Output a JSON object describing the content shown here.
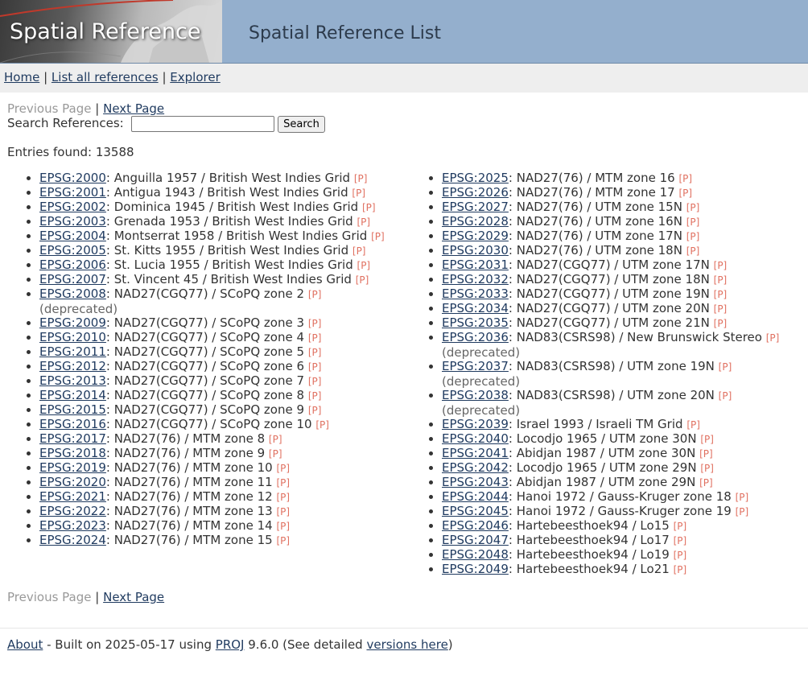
{
  "header": {
    "logo_text": "Spatial Reference",
    "title": "Spatial Reference List"
  },
  "nav": {
    "home": "Home",
    "list_all": "List all references",
    "explorer": "Explorer",
    "separator": "|"
  },
  "pager": {
    "previous": "Previous Page",
    "next": "Next Page",
    "separator": "|"
  },
  "search": {
    "label": "Search References:",
    "value": "",
    "button": "Search"
  },
  "entries_text": "Entries found: 13588",
  "p_tag": "[P]",
  "deprecated_text": "(deprecated)",
  "left_column": [
    {
      "code": "EPSG:2000",
      "name": ": Anguilla 1957 / British West Indies Grid",
      "deprecated": false
    },
    {
      "code": "EPSG:2001",
      "name": ": Antigua 1943 / British West Indies Grid",
      "deprecated": false
    },
    {
      "code": "EPSG:2002",
      "name": ": Dominica 1945 / British West Indies Grid",
      "deprecated": false
    },
    {
      "code": "EPSG:2003",
      "name": ": Grenada 1953 / British West Indies Grid",
      "deprecated": false
    },
    {
      "code": "EPSG:2004",
      "name": ": Montserrat 1958 / British West Indies Grid",
      "deprecated": false
    },
    {
      "code": "EPSG:2005",
      "name": ": St. Kitts 1955 / British West Indies Grid",
      "deprecated": false
    },
    {
      "code": "EPSG:2006",
      "name": ": St. Lucia 1955 / British West Indies Grid",
      "deprecated": false
    },
    {
      "code": "EPSG:2007",
      "name": ": St. Vincent 45 / British West Indies Grid",
      "deprecated": false
    },
    {
      "code": "EPSG:2008",
      "name": ": NAD27(CGQ77) / SCoPQ zone 2",
      "deprecated": true
    },
    {
      "code": "EPSG:2009",
      "name": ": NAD27(CGQ77) / SCoPQ zone 3",
      "deprecated": false
    },
    {
      "code": "EPSG:2010",
      "name": ": NAD27(CGQ77) / SCoPQ zone 4",
      "deprecated": false
    },
    {
      "code": "EPSG:2011",
      "name": ": NAD27(CGQ77) / SCoPQ zone 5",
      "deprecated": false
    },
    {
      "code": "EPSG:2012",
      "name": ": NAD27(CGQ77) / SCoPQ zone 6",
      "deprecated": false
    },
    {
      "code": "EPSG:2013",
      "name": ": NAD27(CGQ77) / SCoPQ zone 7",
      "deprecated": false
    },
    {
      "code": "EPSG:2014",
      "name": ": NAD27(CGQ77) / SCoPQ zone 8",
      "deprecated": false
    },
    {
      "code": "EPSG:2015",
      "name": ": NAD27(CGQ77) / SCoPQ zone 9",
      "deprecated": false
    },
    {
      "code": "EPSG:2016",
      "name": ": NAD27(CGQ77) / SCoPQ zone 10",
      "deprecated": false
    },
    {
      "code": "EPSG:2017",
      "name": ": NAD27(76) / MTM zone 8",
      "deprecated": false
    },
    {
      "code": "EPSG:2018",
      "name": ": NAD27(76) / MTM zone 9",
      "deprecated": false
    },
    {
      "code": "EPSG:2019",
      "name": ": NAD27(76) / MTM zone 10",
      "deprecated": false
    },
    {
      "code": "EPSG:2020",
      "name": ": NAD27(76) / MTM zone 11",
      "deprecated": false
    },
    {
      "code": "EPSG:2021",
      "name": ": NAD27(76) / MTM zone 12",
      "deprecated": false
    },
    {
      "code": "EPSG:2022",
      "name": ": NAD27(76) / MTM zone 13",
      "deprecated": false
    },
    {
      "code": "EPSG:2023",
      "name": ": NAD27(76) / MTM zone 14",
      "deprecated": false
    },
    {
      "code": "EPSG:2024",
      "name": ": NAD27(76) / MTM zone 15",
      "deprecated": false
    }
  ],
  "right_column": [
    {
      "code": "EPSG:2025",
      "name": ": NAD27(76) / MTM zone 16",
      "deprecated": false
    },
    {
      "code": "EPSG:2026",
      "name": ": NAD27(76) / MTM zone 17",
      "deprecated": false
    },
    {
      "code": "EPSG:2027",
      "name": ": NAD27(76) / UTM zone 15N",
      "deprecated": false
    },
    {
      "code": "EPSG:2028",
      "name": ": NAD27(76) / UTM zone 16N",
      "deprecated": false
    },
    {
      "code": "EPSG:2029",
      "name": ": NAD27(76) / UTM zone 17N",
      "deprecated": false
    },
    {
      "code": "EPSG:2030",
      "name": ": NAD27(76) / UTM zone 18N",
      "deprecated": false
    },
    {
      "code": "EPSG:2031",
      "name": ": NAD27(CGQ77) / UTM zone 17N",
      "deprecated": false
    },
    {
      "code": "EPSG:2032",
      "name": ": NAD27(CGQ77) / UTM zone 18N",
      "deprecated": false
    },
    {
      "code": "EPSG:2033",
      "name": ": NAD27(CGQ77) / UTM zone 19N",
      "deprecated": false
    },
    {
      "code": "EPSG:2034",
      "name": ": NAD27(CGQ77) / UTM zone 20N",
      "deprecated": false
    },
    {
      "code": "EPSG:2035",
      "name": ": NAD27(CGQ77) / UTM zone 21N",
      "deprecated": false
    },
    {
      "code": "EPSG:2036",
      "name": ": NAD83(CSRS98) / New Brunswick Stereo",
      "deprecated": true
    },
    {
      "code": "EPSG:2037",
      "name": ": NAD83(CSRS98) / UTM zone 19N",
      "deprecated": true
    },
    {
      "code": "EPSG:2038",
      "name": ": NAD83(CSRS98) / UTM zone 20N",
      "deprecated": true
    },
    {
      "code": "EPSG:2039",
      "name": ": Israel 1993 / Israeli TM Grid",
      "deprecated": false
    },
    {
      "code": "EPSG:2040",
      "name": ": Locodjo 1965 / UTM zone 30N",
      "deprecated": false
    },
    {
      "code": "EPSG:2041",
      "name": ": Abidjan 1987 / UTM zone 30N",
      "deprecated": false
    },
    {
      "code": "EPSG:2042",
      "name": ": Locodjo 1965 / UTM zone 29N",
      "deprecated": false
    },
    {
      "code": "EPSG:2043",
      "name": ": Abidjan 1987 / UTM zone 29N",
      "deprecated": false
    },
    {
      "code": "EPSG:2044",
      "name": ": Hanoi 1972 / Gauss-Kruger zone 18",
      "deprecated": false
    },
    {
      "code": "EPSG:2045",
      "name": ": Hanoi 1972 / Gauss-Kruger zone 19",
      "deprecated": false
    },
    {
      "code": "EPSG:2046",
      "name": ": Hartebeesthoek94 / Lo15",
      "deprecated": false
    },
    {
      "code": "EPSG:2047",
      "name": ": Hartebeesthoek94 / Lo17",
      "deprecated": false
    },
    {
      "code": "EPSG:2048",
      "name": ": Hartebeesthoek94 / Lo19",
      "deprecated": false
    },
    {
      "code": "EPSG:2049",
      "name": ": Hartebeesthoek94 / Lo21",
      "deprecated": false
    }
  ],
  "footer": {
    "about": "About",
    "built_prefix": " - Built on 2025-05-17 using ",
    "proj_link": "PROJ",
    "version_prefix": " 9.6.0 (See detailed ",
    "versions_link": "versions here",
    "closing": ")"
  },
  "colors": {
    "header_bg": "#94afcd",
    "nav_bg": "#eeeeee",
    "link": "#1f3a5f",
    "p_tag": "#e07060",
    "disabled": "#999999"
  }
}
